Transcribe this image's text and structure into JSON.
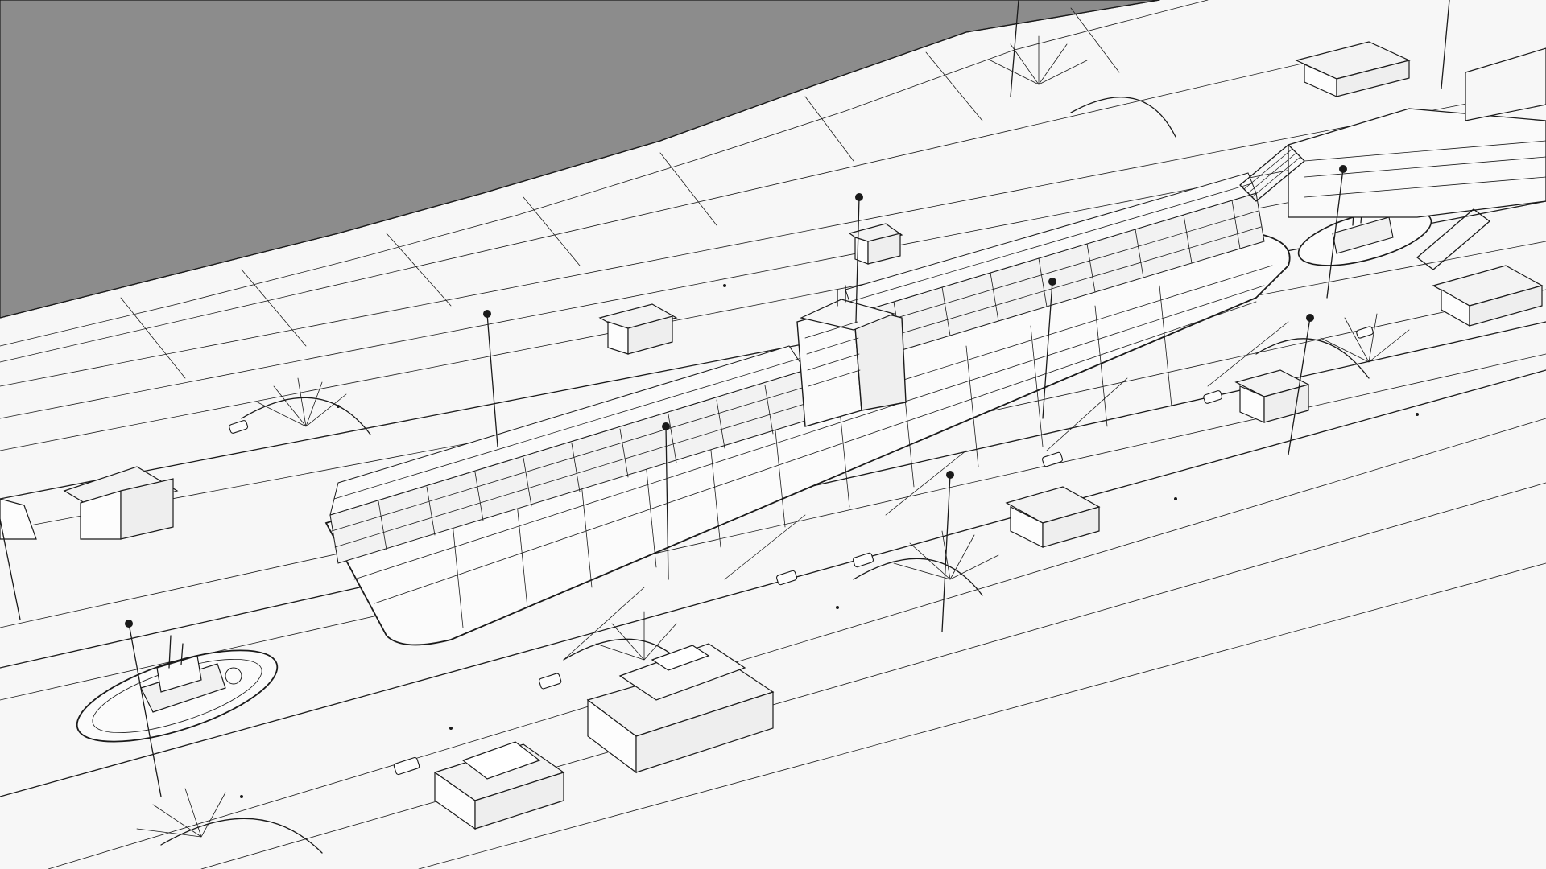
{
  "scene": {
    "title": "",
    "description_visible_text": "",
    "colors": {
      "background": "#f5f5f5",
      "sea": "#8c8c8c",
      "line": "#1a1a1a",
      "surface": "#fbfbfb",
      "container": "#f2f2f2"
    },
    "objects": [
      {
        "id": "container-ship",
        "kind": "ship"
      },
      {
        "id": "tugboat-bow",
        "kind": "tugboat"
      },
      {
        "id": "tugboat-stern",
        "kind": "tugboat"
      },
      {
        "id": "lock-chamber",
        "kind": "canal-lock"
      },
      {
        "id": "control-buildings",
        "kind": "buildings"
      },
      {
        "id": "light-poles",
        "kind": "poles"
      },
      {
        "id": "vehicles",
        "kind": "cars"
      }
    ]
  }
}
